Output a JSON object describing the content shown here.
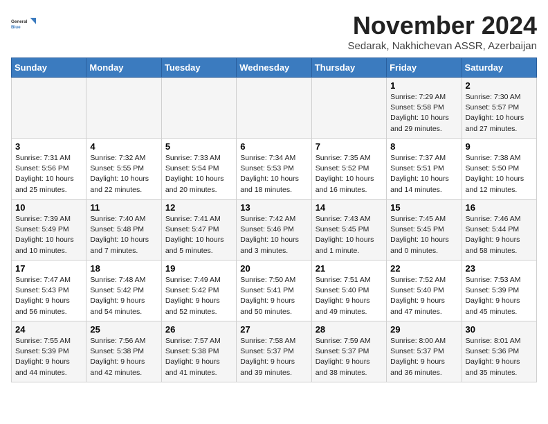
{
  "logo": {
    "line1": "General",
    "line2": "Blue"
  },
  "title": "November 2024",
  "subtitle": "Sedarak, Nakhichevan ASSR, Azerbaijan",
  "headers": [
    "Sunday",
    "Monday",
    "Tuesday",
    "Wednesday",
    "Thursday",
    "Friday",
    "Saturday"
  ],
  "weeks": [
    [
      {
        "day": "",
        "info": ""
      },
      {
        "day": "",
        "info": ""
      },
      {
        "day": "",
        "info": ""
      },
      {
        "day": "",
        "info": ""
      },
      {
        "day": "",
        "info": ""
      },
      {
        "day": "1",
        "info": "Sunrise: 7:29 AM\nSunset: 5:58 PM\nDaylight: 10 hours\nand 29 minutes."
      },
      {
        "day": "2",
        "info": "Sunrise: 7:30 AM\nSunset: 5:57 PM\nDaylight: 10 hours\nand 27 minutes."
      }
    ],
    [
      {
        "day": "3",
        "info": "Sunrise: 7:31 AM\nSunset: 5:56 PM\nDaylight: 10 hours\nand 25 minutes."
      },
      {
        "day": "4",
        "info": "Sunrise: 7:32 AM\nSunset: 5:55 PM\nDaylight: 10 hours\nand 22 minutes."
      },
      {
        "day": "5",
        "info": "Sunrise: 7:33 AM\nSunset: 5:54 PM\nDaylight: 10 hours\nand 20 minutes."
      },
      {
        "day": "6",
        "info": "Sunrise: 7:34 AM\nSunset: 5:53 PM\nDaylight: 10 hours\nand 18 minutes."
      },
      {
        "day": "7",
        "info": "Sunrise: 7:35 AM\nSunset: 5:52 PM\nDaylight: 10 hours\nand 16 minutes."
      },
      {
        "day": "8",
        "info": "Sunrise: 7:37 AM\nSunset: 5:51 PM\nDaylight: 10 hours\nand 14 minutes."
      },
      {
        "day": "9",
        "info": "Sunrise: 7:38 AM\nSunset: 5:50 PM\nDaylight: 10 hours\nand 12 minutes."
      }
    ],
    [
      {
        "day": "10",
        "info": "Sunrise: 7:39 AM\nSunset: 5:49 PM\nDaylight: 10 hours\nand 10 minutes."
      },
      {
        "day": "11",
        "info": "Sunrise: 7:40 AM\nSunset: 5:48 PM\nDaylight: 10 hours\nand 7 minutes."
      },
      {
        "day": "12",
        "info": "Sunrise: 7:41 AM\nSunset: 5:47 PM\nDaylight: 10 hours\nand 5 minutes."
      },
      {
        "day": "13",
        "info": "Sunrise: 7:42 AM\nSunset: 5:46 PM\nDaylight: 10 hours\nand 3 minutes."
      },
      {
        "day": "14",
        "info": "Sunrise: 7:43 AM\nSunset: 5:45 PM\nDaylight: 10 hours\nand 1 minute."
      },
      {
        "day": "15",
        "info": "Sunrise: 7:45 AM\nSunset: 5:45 PM\nDaylight: 10 hours\nand 0 minutes."
      },
      {
        "day": "16",
        "info": "Sunrise: 7:46 AM\nSunset: 5:44 PM\nDaylight: 9 hours\nand 58 minutes."
      }
    ],
    [
      {
        "day": "17",
        "info": "Sunrise: 7:47 AM\nSunset: 5:43 PM\nDaylight: 9 hours\nand 56 minutes."
      },
      {
        "day": "18",
        "info": "Sunrise: 7:48 AM\nSunset: 5:42 PM\nDaylight: 9 hours\nand 54 minutes."
      },
      {
        "day": "19",
        "info": "Sunrise: 7:49 AM\nSunset: 5:42 PM\nDaylight: 9 hours\nand 52 minutes."
      },
      {
        "day": "20",
        "info": "Sunrise: 7:50 AM\nSunset: 5:41 PM\nDaylight: 9 hours\nand 50 minutes."
      },
      {
        "day": "21",
        "info": "Sunrise: 7:51 AM\nSunset: 5:40 PM\nDaylight: 9 hours\nand 49 minutes."
      },
      {
        "day": "22",
        "info": "Sunrise: 7:52 AM\nSunset: 5:40 PM\nDaylight: 9 hours\nand 47 minutes."
      },
      {
        "day": "23",
        "info": "Sunrise: 7:53 AM\nSunset: 5:39 PM\nDaylight: 9 hours\nand 45 minutes."
      }
    ],
    [
      {
        "day": "24",
        "info": "Sunrise: 7:55 AM\nSunset: 5:39 PM\nDaylight: 9 hours\nand 44 minutes."
      },
      {
        "day": "25",
        "info": "Sunrise: 7:56 AM\nSunset: 5:38 PM\nDaylight: 9 hours\nand 42 minutes."
      },
      {
        "day": "26",
        "info": "Sunrise: 7:57 AM\nSunset: 5:38 PM\nDaylight: 9 hours\nand 41 minutes."
      },
      {
        "day": "27",
        "info": "Sunrise: 7:58 AM\nSunset: 5:37 PM\nDaylight: 9 hours\nand 39 minutes."
      },
      {
        "day": "28",
        "info": "Sunrise: 7:59 AM\nSunset: 5:37 PM\nDaylight: 9 hours\nand 38 minutes."
      },
      {
        "day": "29",
        "info": "Sunrise: 8:00 AM\nSunset: 5:37 PM\nDaylight: 9 hours\nand 36 minutes."
      },
      {
        "day": "30",
        "info": "Sunrise: 8:01 AM\nSunset: 5:36 PM\nDaylight: 9 hours\nand 35 minutes."
      }
    ]
  ]
}
